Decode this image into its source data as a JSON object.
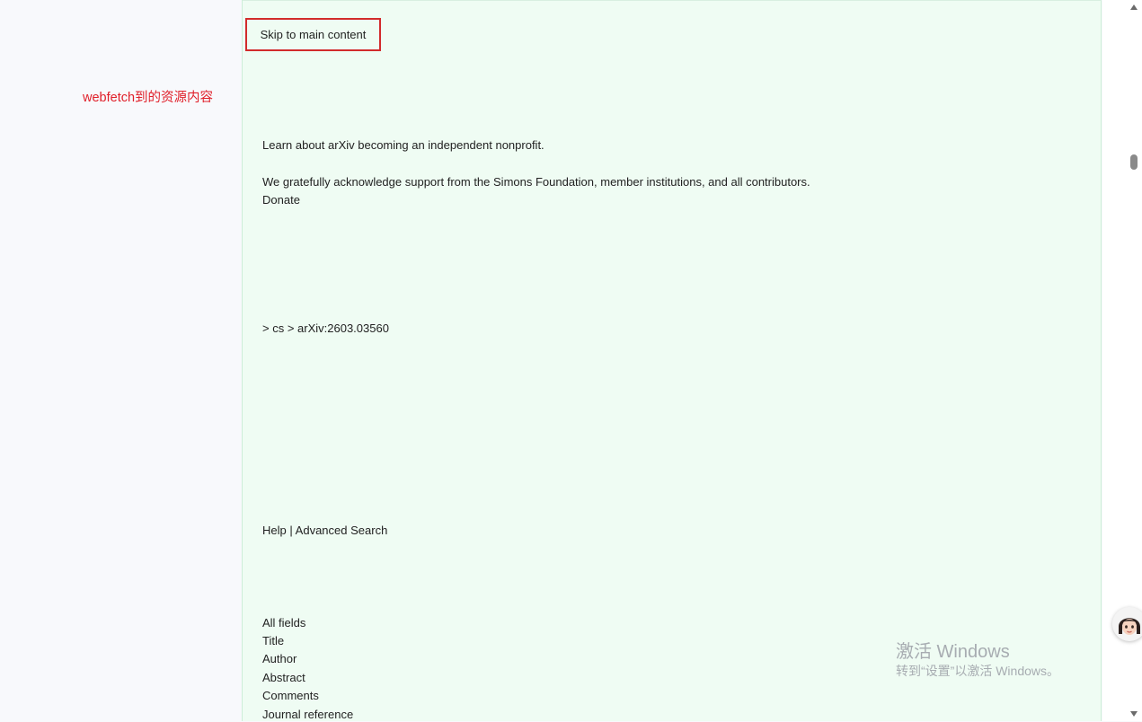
{
  "annotation": {
    "text": "webfetch到的资源内容",
    "color": "#e0202a"
  },
  "content": {
    "skip_link": "Skip to main content",
    "announcement": "Learn about arXiv becoming an independent nonprofit.",
    "acknowledgement": "We gratefully acknowledge support from the Simons Foundation, member institutions, and all contributors.",
    "donate": "Donate",
    "breadcrumb": "> cs > arXiv:2603.03560",
    "help": "Help",
    "separator": "|",
    "advanced_search": "Advanced Search",
    "search_fields": [
      "All fields",
      "Title",
      "Author",
      "Abstract",
      "Comments",
      "Journal reference"
    ],
    "background_color": "#effcf3",
    "highlight_border_color": "#d22b2b"
  },
  "watermark": {
    "title": "激活 Windows",
    "subtitle": "转到“设置”以激活 Windows。"
  },
  "scrollbar": {
    "up_icon": "triangle-up-icon",
    "down_icon": "triangle-down-icon"
  },
  "assistant": {
    "icon": "avatar-icon"
  }
}
